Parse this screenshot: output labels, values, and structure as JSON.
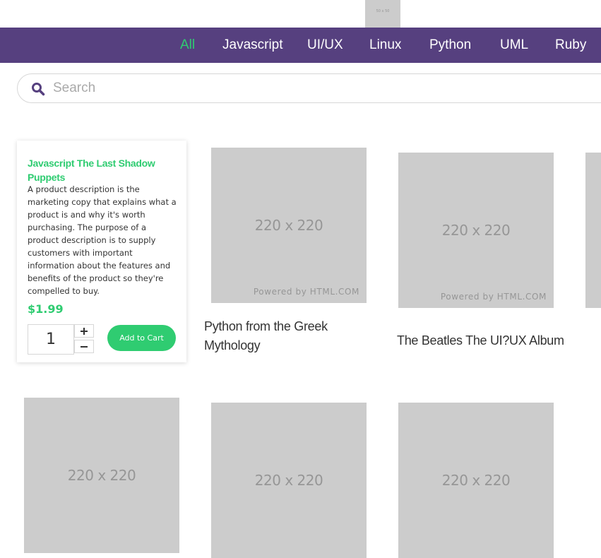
{
  "header": {
    "logo_text": "50 x 50"
  },
  "nav": {
    "items": [
      {
        "label": "All",
        "active": true
      },
      {
        "label": "Javascript",
        "active": false
      },
      {
        "label": "UI/UX",
        "active": false
      },
      {
        "label": "Linux",
        "active": false
      },
      {
        "label": "Python",
        "active": false
      },
      {
        "label": "UML",
        "active": false
      },
      {
        "label": "Ruby",
        "active": false
      }
    ]
  },
  "search": {
    "placeholder": "Search",
    "value": "",
    "icon": "search-icon"
  },
  "colors": {
    "nav_background": "#56407f",
    "accent": "#2fcc71",
    "placeholder_gray": "#cccccc"
  },
  "featured": {
    "title": "Javascript The Last Shadow Puppets",
    "description": "A product description is the marketing copy that explains what a product is and why it's worth purchasing. The purpose of a product description is to supply customers with important information about the features and benefits of the product so they're compelled to buy.",
    "price": "$1.99",
    "quantity": "1",
    "add_to_cart_label": "Add to Cart",
    "increment_icon": "plus-icon",
    "decrement_icon": "minus-icon"
  },
  "products": [
    {
      "image_text": "220 x 220",
      "credit": "Powered by HTML.COM",
      "title": "Python from the Greek Mythology"
    },
    {
      "image_text": "220 x 220",
      "credit": "Powered by HTML.COM",
      "title": "The Beatles The UI?UX Album"
    },
    {
      "image_text": "220 x 220"
    },
    {
      "image_text": "220 x 220"
    },
    {
      "image_text": "220 x 220"
    }
  ]
}
